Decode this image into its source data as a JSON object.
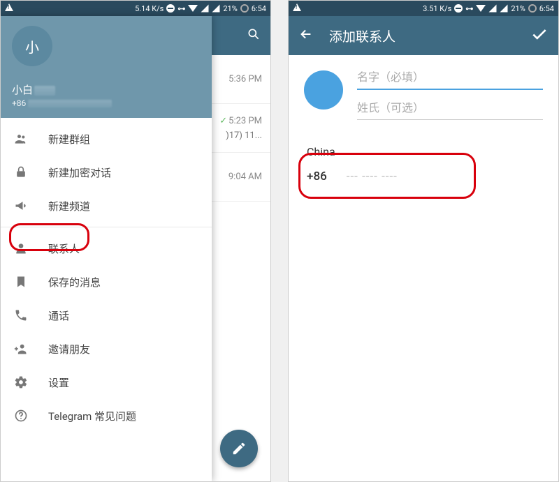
{
  "status_bar": {
    "speed_left": "5.14 K/s",
    "speed_right": "3.51 K/s",
    "battery": "21%",
    "time": "6:54"
  },
  "left_phone": {
    "drawer": {
      "avatar_initial": "小",
      "user_name": "小白",
      "user_phone_prefix": "+86",
      "menu": [
        {
          "icon": "group-icon",
          "label": "新建群组"
        },
        {
          "icon": "lock-icon",
          "label": "新建加密对话"
        },
        {
          "icon": "megaphone-icon",
          "label": "新建频道"
        },
        {
          "icon": "contact-icon",
          "label": "联系人"
        },
        {
          "icon": "bookmark-icon",
          "label": "保存的消息"
        },
        {
          "icon": "phone-icon",
          "label": "通话"
        },
        {
          "icon": "invite-icon",
          "label": "邀请朋友"
        },
        {
          "icon": "gear-icon",
          "label": "设置"
        },
        {
          "icon": "help-icon",
          "label": "Telegram 常见问题"
        }
      ]
    },
    "chats": [
      {
        "time": "5:36 PM"
      },
      {
        "time": "5:23 PM",
        "sub": ")17) 11...",
        "checked": true
      },
      {
        "time": "9:04 AM"
      }
    ]
  },
  "right_phone": {
    "title": "添加联系人",
    "first_name_placeholder": "名字（必填）",
    "last_name_placeholder": "姓氏（可选）",
    "country": "China",
    "country_code": "+86",
    "phone_placeholder": "--- ---- ----"
  }
}
